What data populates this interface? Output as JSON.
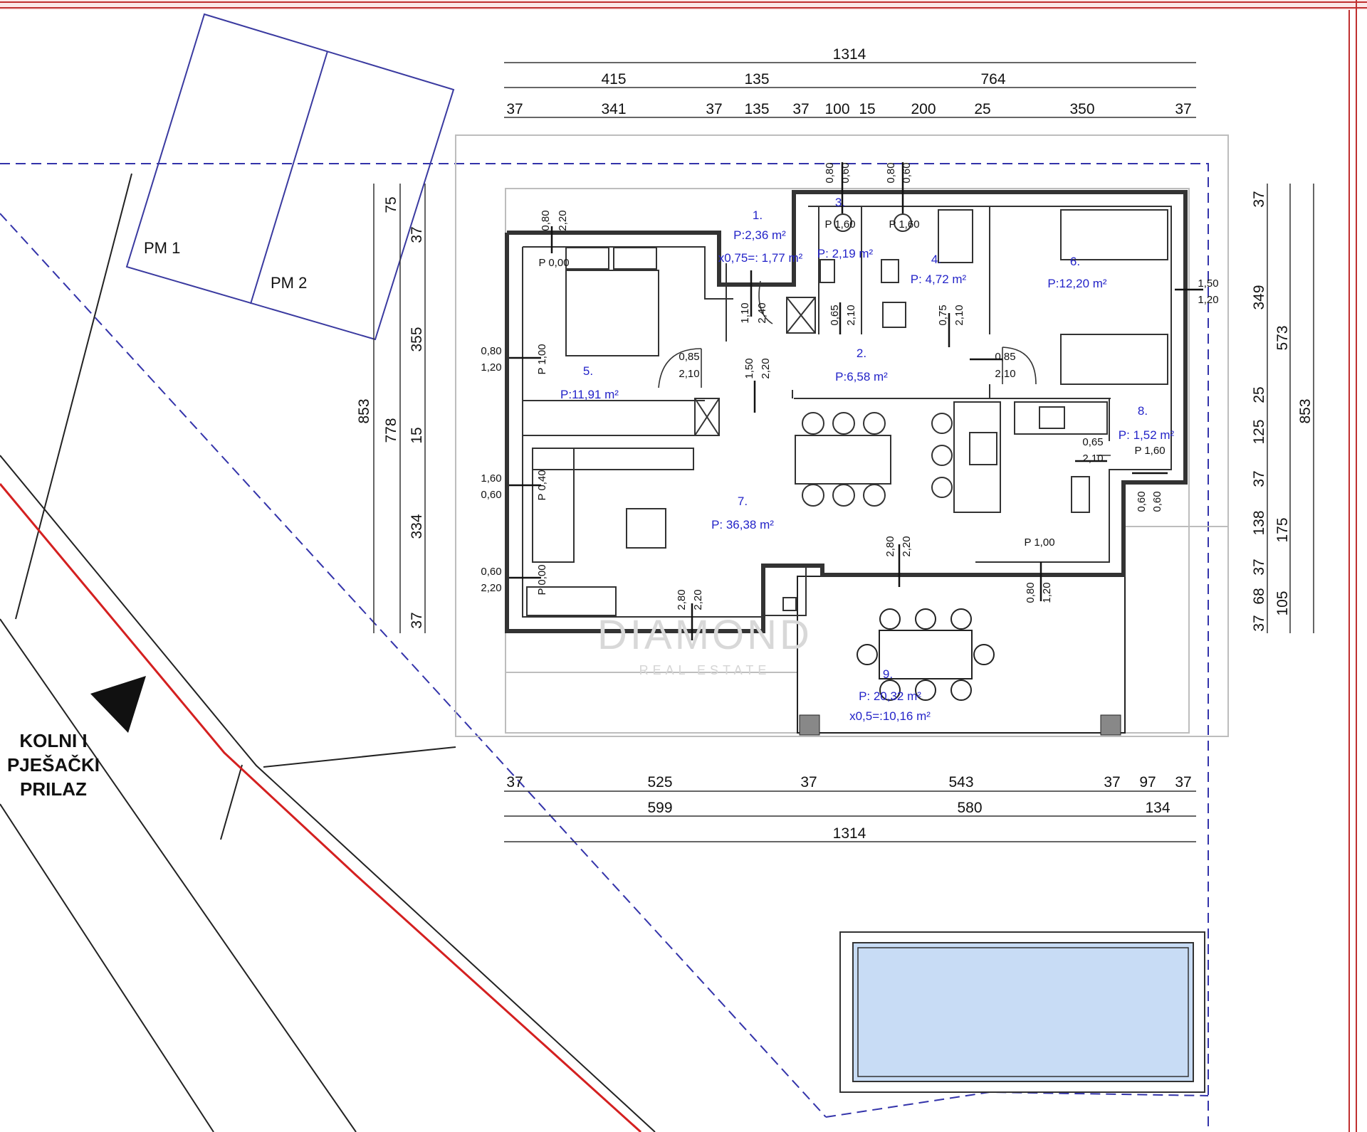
{
  "dims_top": {
    "total": "1314",
    "seg1": "415",
    "seg2": "135",
    "seg3": "764",
    "d1": "37",
    "d2": "341",
    "d3": "37",
    "d4": "135",
    "d5": "37",
    "d6": "100",
    "d7": "15",
    "d8": "200",
    "d9": "25",
    "d10": "350",
    "d11": "37"
  },
  "dims_bottom": {
    "d1": "37",
    "d2": "525",
    "d3": "37",
    "d4": "543",
    "d5": "37",
    "d6": "97",
    "d7": "37",
    "seg1": "599",
    "seg2": "580",
    "seg3": "134",
    "total": "1314"
  },
  "dims_left": {
    "total": "853",
    "sub": "778",
    "d1": "75",
    "d2": "37",
    "d3": "355",
    "d4": "15",
    "d5": "334",
    "d6": "37"
  },
  "dims_right": {
    "total": "853",
    "mid": "573",
    "d1": "37",
    "d2": "349",
    "d3": "25",
    "d4": "125",
    "d5": "37",
    "d6": "138",
    "d7": "175",
    "d8": "37",
    "d9": "68",
    "d10": "37",
    "d11": "105"
  },
  "rooms": [
    {
      "num": "1.",
      "area": "P:2,36 m²",
      "extra": "x0,75=: 1,77 m²"
    },
    {
      "num": "3.",
      "area": "P: 2,19 m²"
    },
    {
      "num": "4.",
      "area": "P: 4,72 m²"
    },
    {
      "num": "6.",
      "area": "P:12,20 m²"
    },
    {
      "num": "5.",
      "area": "P:11,91 m²"
    },
    {
      "num": "2.",
      "area": "P:6,58 m²"
    },
    {
      "num": "8.",
      "area": "P: 1,52 m²"
    },
    {
      "num": "7.",
      "area": "P: 36,38 m²"
    },
    {
      "num": "9.",
      "area": "P: 20,32 m²",
      "extra": "x0,5=:10,16 m²"
    }
  ],
  "openings": {
    "o1": "0,80",
    "o1b": "2,20",
    "o1p": "P 0,00",
    "o2": "0,80",
    "o2b": "1,20",
    "o2p": "P 1,00",
    "o3": "0,85",
    "o3b": "2,10",
    "o4": "1,50",
    "o4b": "2,20",
    "o5": "1,10",
    "o5b": "2,40",
    "o6": "0,65",
    "o6b": "2,10",
    "o7": "0,75",
    "o7b": "2,10",
    "o8": "0,85",
    "o8b": "2,10",
    "o9": "1,50",
    "o9b": "1,20",
    "o10": "0,80",
    "o10b": "0,60",
    "o10p": "P 1,60",
    "o11": "0,80",
    "o11b": "0,60",
    "o11p": "P 1,60",
    "o12": "1,60",
    "o12b": "0,60",
    "o12p": "P 0,40",
    "o13": "0,60",
    "o13b": "2,20",
    "o13p": "P 0,00",
    "o14": "2,80",
    "o14b": "2,20",
    "o15": "2,80",
    "o15b": "2,20",
    "o16": "0,80",
    "o16b": "1,20",
    "o16p": "P 1,00",
    "o17": "0,65",
    "o17b": "2,10",
    "o18": "0,60",
    "o18b": "0,60",
    "o18p": "P 1,60"
  },
  "parking": {
    "pm1": "PM 1",
    "pm2": "PM 2"
  },
  "access_label": [
    "KOLNI I",
    "PJEŠAČKI",
    "PRILAZ"
  ],
  "watermark": {
    "brand": "DIAMOND",
    "sub": "REAL ESTATE"
  },
  "colors": {
    "frame": "#c03030",
    "parcel": "#3333aa",
    "road_red": "#d42020",
    "wall": "#333333",
    "pool": "#c8dcf5",
    "room_text": "#2323c8"
  }
}
